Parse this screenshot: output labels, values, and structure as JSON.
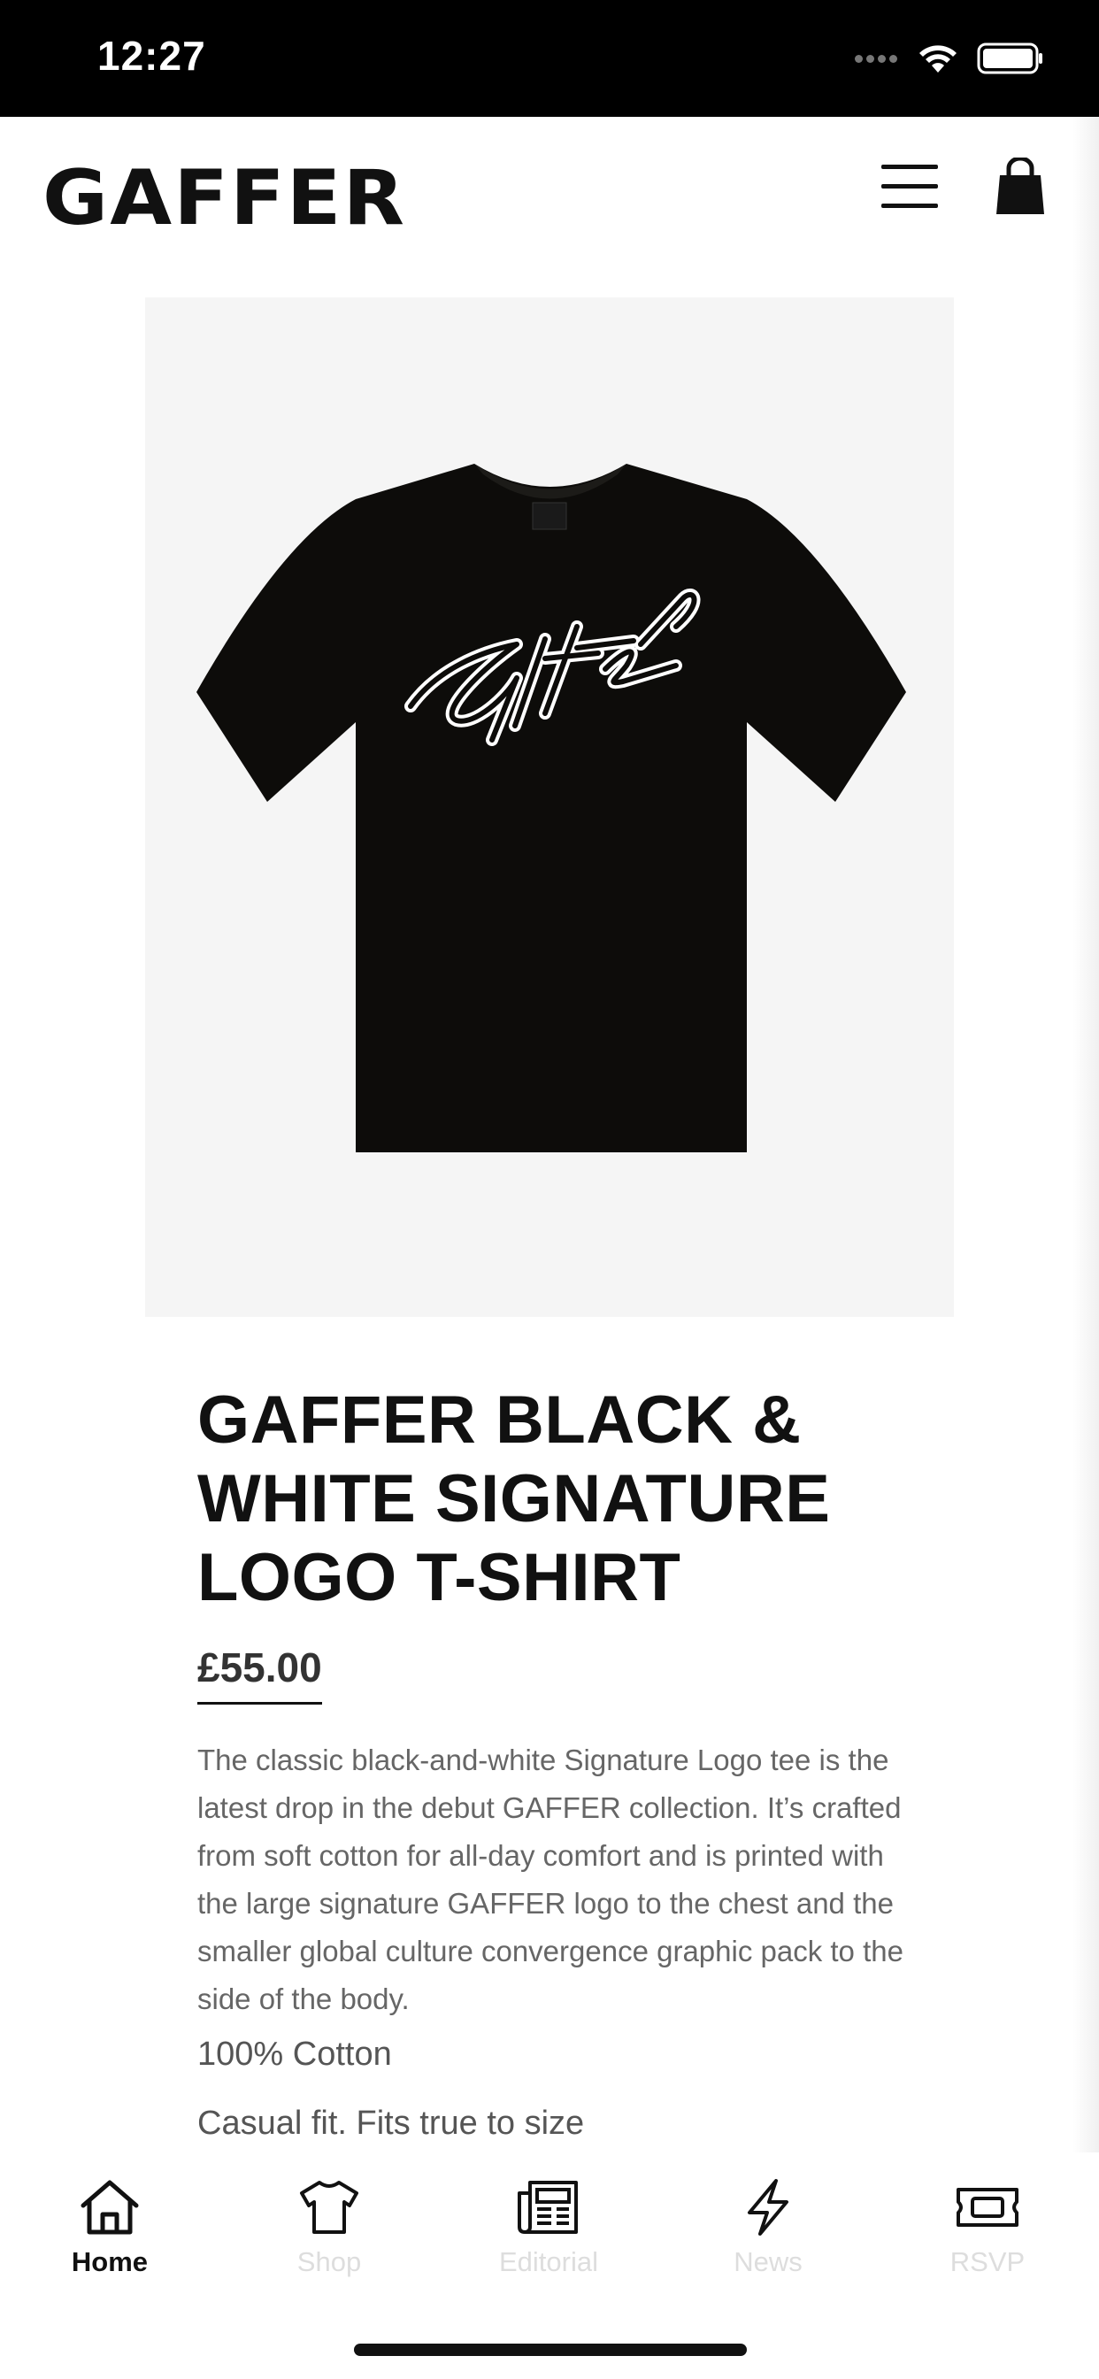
{
  "status_bar": {
    "time": "12:27"
  },
  "header": {
    "logo": "GAFFER",
    "menu_icon": "hamburger-menu-icon",
    "cart_icon": "shopping-bag-icon"
  },
  "product": {
    "image_alt": "black t-shirt with white signature logo",
    "title": "GAFFER BLACK & WHITE SIGNATURE LOGO T-SHIRT",
    "price": "£55.00",
    "description": "The classic black-and-white Signature Logo tee is the latest drop in the debut GAFFER collection. It’s crafted from soft cotton for all-day comfort and is printed with the large signature GAFFER logo to the chest and the smaller global culture convergence graphic pack to the side of the body.",
    "material": "100% Cotton",
    "fit": "Casual fit. Fits true to size"
  },
  "tab_bar": {
    "tabs": [
      {
        "label": "Home",
        "icon": "home-icon",
        "active": true
      },
      {
        "label": "Shop",
        "icon": "tshirt-icon",
        "active": false
      },
      {
        "label": "Editorial",
        "icon": "newspaper-icon",
        "active": false
      },
      {
        "label": "News",
        "icon": "lightning-icon",
        "active": false
      },
      {
        "label": "RSVP",
        "icon": "ticket-icon",
        "active": false
      }
    ]
  },
  "colors": {
    "status_bar_bg": "#000000",
    "text_primary": "#111111",
    "image_bg": "#f5f5f5",
    "inactive_tab": "#dddddd"
  }
}
